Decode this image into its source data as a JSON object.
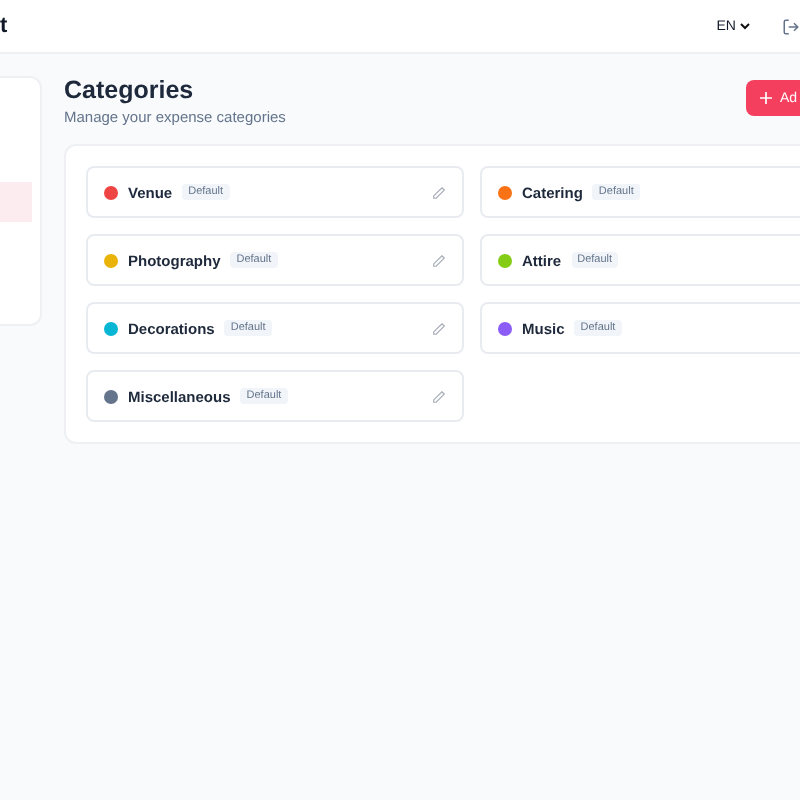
{
  "header": {
    "brand": "t",
    "language": "EN"
  },
  "page": {
    "title": "Categories",
    "subtitle": "Manage your expense categories",
    "add_button": "Ad"
  },
  "categories": [
    {
      "name": "Venue",
      "badge": "Default",
      "color": "#ef4444"
    },
    {
      "name": "Catering",
      "badge": "Default",
      "color": "#f97316"
    },
    {
      "name": "Photography",
      "badge": "Default",
      "color": "#eab308"
    },
    {
      "name": "Attire",
      "badge": "Default",
      "color": "#84cc16"
    },
    {
      "name": "Decorations",
      "badge": "Default",
      "color": "#06b6d4"
    },
    {
      "name": "Music",
      "badge": "Default",
      "color": "#8b5cf6"
    },
    {
      "name": "Miscellaneous",
      "badge": "Default",
      "color": "#64748b"
    }
  ]
}
